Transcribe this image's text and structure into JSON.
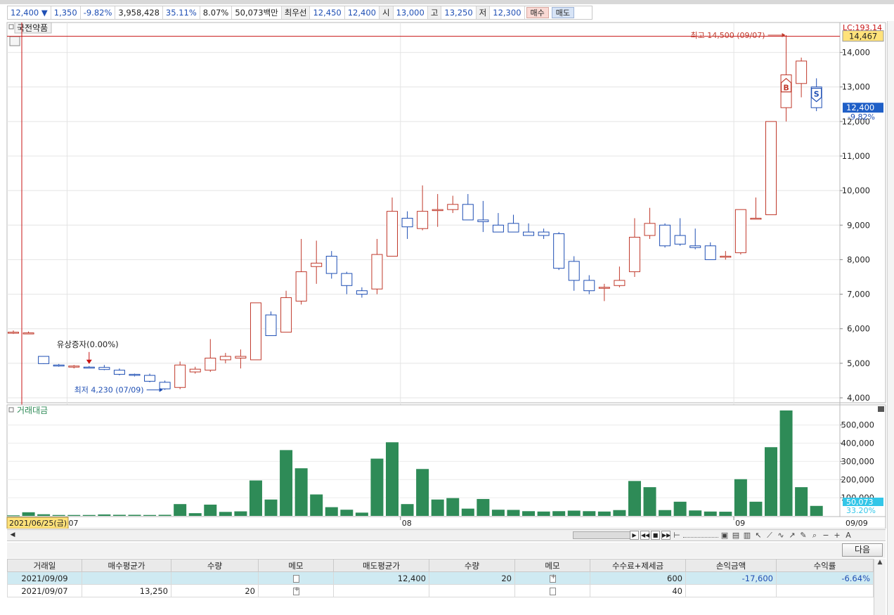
{
  "quote_bar": {
    "price": "12,400",
    "direction_icon": "triangle-down-icon",
    "change": "1,350",
    "change_rate": "-9.82%",
    "volume": "3,958,428",
    "rate2": "35.11%",
    "rate3": "8.07%",
    "amount": "50,073백만",
    "best_label": "최우선",
    "best_ask": "12,450",
    "best_bid": "12,400",
    "open_label": "시",
    "open": "13,000",
    "high_label": "고",
    "high": "13,250",
    "low_label": "저",
    "low": "12,300",
    "buy_label": "매수",
    "sell_label": "매도"
  },
  "price_panel": {
    "title": "국전약품",
    "lc_label": "LC:193.14",
    "crosshair_value": "14,467",
    "last_price": "12,400",
    "last_rate": "-9.82%",
    "high_note": "최고 14,500 (09/07)",
    "low_note": "최저 4,230 (07/09)",
    "event_note": "유상증자(0.00%)",
    "buy_marker": "B",
    "sell_marker": "S"
  },
  "volume_panel": {
    "title": "거래대금",
    "last_value": "50,073",
    "last_rate": "33.20%"
  },
  "x_axis": {
    "cursor_date": "2021/06/25(금)",
    "month_labels": [
      "07",
      "08",
      "09"
    ],
    "end_label": "09/09"
  },
  "chart_data": {
    "type": "candlestick",
    "price_ylim": [
      4000,
      14500
    ],
    "price_ticks": [
      4000,
      5000,
      6000,
      7000,
      8000,
      9000,
      10000,
      11000,
      12000,
      13000,
      14000
    ],
    "price_tick_labels": [
      "4,000",
      "5,000",
      "6,000",
      "7,000",
      "8,000",
      "9,000",
      "10,000",
      "11,000",
      "12,000",
      "13,000",
      "14,000"
    ],
    "volume_ylim": [
      0,
      580000
    ],
    "volume_ticks": [
      100000,
      200000,
      300000,
      400000,
      500000
    ],
    "volume_tick_labels": [
      "100,000",
      "200,000",
      "300,000",
      "400,000",
      "500,000"
    ],
    "candles": [
      {
        "o": 5900,
        "h": 5950,
        "l": 5850,
        "c": 5900
      },
      {
        "o": 5880,
        "h": 5920,
        "l": 5860,
        "c": 5880
      },
      {
        "o": 5200,
        "h": 5200,
        "l": 4980,
        "c": 4990
      },
      {
        "o": 4950,
        "h": 4980,
        "l": 4900,
        "c": 4930
      },
      {
        "o": 4900,
        "h": 4950,
        "l": 4850,
        "c": 4920
      },
      {
        "o": 4890,
        "h": 4920,
        "l": 4860,
        "c": 4870
      },
      {
        "o": 4880,
        "h": 4950,
        "l": 4800,
        "c": 4820
      },
      {
        "o": 4800,
        "h": 4850,
        "l": 4650,
        "c": 4680
      },
      {
        "o": 4680,
        "h": 4700,
        "l": 4620,
        "c": 4650
      },
      {
        "o": 4650,
        "h": 4700,
        "l": 4450,
        "c": 4480
      },
      {
        "o": 4450,
        "h": 4500,
        "l": 4230,
        "c": 4260
      },
      {
        "o": 4300,
        "h": 5050,
        "l": 4250,
        "c": 4950
      },
      {
        "o": 4750,
        "h": 4900,
        "l": 4700,
        "c": 4830
      },
      {
        "o": 4800,
        "h": 5700,
        "l": 4750,
        "c": 5150
      },
      {
        "o": 5100,
        "h": 5300,
        "l": 5000,
        "c": 5200
      },
      {
        "o": 5150,
        "h": 5400,
        "l": 4850,
        "c": 5200
      },
      {
        "o": 5100,
        "h": 6750,
        "l": 5100,
        "c": 6750
      },
      {
        "o": 6400,
        "h": 6500,
        "l": 5800,
        "c": 5800
      },
      {
        "o": 5900,
        "h": 7100,
        "l": 5900,
        "c": 6900
      },
      {
        "o": 6800,
        "h": 8600,
        "l": 6700,
        "c": 7650
      },
      {
        "o": 7800,
        "h": 8550,
        "l": 7300,
        "c": 7900
      },
      {
        "o": 8100,
        "h": 8250,
        "l": 7450,
        "c": 7600
      },
      {
        "o": 7600,
        "h": 7650,
        "l": 7000,
        "c": 7250
      },
      {
        "o": 7100,
        "h": 7200,
        "l": 6900,
        "c": 7000
      },
      {
        "o": 7150,
        "h": 8600,
        "l": 7000,
        "c": 8150
      },
      {
        "o": 8100,
        "h": 9800,
        "l": 8100,
        "c": 9400
      },
      {
        "o": 9200,
        "h": 9400,
        "l": 8600,
        "c": 8950
      },
      {
        "o": 8900,
        "h": 10150,
        "l": 8850,
        "c": 9400
      },
      {
        "o": 9450,
        "h": 9900,
        "l": 8950,
        "c": 9450
      },
      {
        "o": 9450,
        "h": 9850,
        "l": 9350,
        "c": 9600
      },
      {
        "o": 9600,
        "h": 9900,
        "l": 9150,
        "c": 9150
      },
      {
        "o": 9150,
        "h": 9700,
        "l": 8800,
        "c": 9100
      },
      {
        "o": 9000,
        "h": 9350,
        "l": 8800,
        "c": 8800
      },
      {
        "o": 9050,
        "h": 9300,
        "l": 8800,
        "c": 8800
      },
      {
        "o": 8800,
        "h": 9050,
        "l": 8700,
        "c": 8700
      },
      {
        "o": 8800,
        "h": 8900,
        "l": 8600,
        "c": 8700
      },
      {
        "o": 8750,
        "h": 8800,
        "l": 7700,
        "c": 7750
      },
      {
        "o": 7950,
        "h": 8100,
        "l": 7100,
        "c": 7400
      },
      {
        "o": 7400,
        "h": 7550,
        "l": 7000,
        "c": 7100
      },
      {
        "o": 7200,
        "h": 7300,
        "l": 6800,
        "c": 7200
      },
      {
        "o": 7250,
        "h": 7800,
        "l": 7200,
        "c": 7400
      },
      {
        "o": 7650,
        "h": 9200,
        "l": 7500,
        "c": 8650
      },
      {
        "o": 8700,
        "h": 9500,
        "l": 8600,
        "c": 9050
      },
      {
        "o": 9000,
        "h": 9050,
        "l": 8350,
        "c": 8400
      },
      {
        "o": 8700,
        "h": 9200,
        "l": 8400,
        "c": 8450
      },
      {
        "o": 8400,
        "h": 8900,
        "l": 8300,
        "c": 8350
      },
      {
        "o": 8400,
        "h": 8500,
        "l": 8000,
        "c": 8000
      },
      {
        "o": 8100,
        "h": 8250,
        "l": 8000,
        "c": 8100
      },
      {
        "o": 8200,
        "h": 9450,
        "l": 8150,
        "c": 9450
      },
      {
        "o": 9200,
        "h": 9800,
        "l": 9200,
        "c": 9200
      },
      {
        "o": 9300,
        "h": 12000,
        "l": 9300,
        "c": 12000
      },
      {
        "o": 12400,
        "h": 14500,
        "l": 12000,
        "c": 13350
      },
      {
        "o": 13100,
        "h": 13850,
        "l": 12700,
        "c": 13750
      },
      {
        "o": 13000,
        "h": 13250,
        "l": 12300,
        "c": 12400
      }
    ],
    "volumes": [
      3000,
      20000,
      9000,
      5000,
      5000,
      5000,
      8000,
      6000,
      6000,
      5000,
      6000,
      65000,
      15000,
      62000,
      22000,
      25000,
      195000,
      90000,
      362000,
      262000,
      118000,
      48000,
      34000,
      18000,
      315000,
      405000,
      65000,
      258000,
      90000,
      98000,
      40000,
      93000,
      34000,
      33000,
      26000,
      24000,
      26000,
      29000,
      26000,
      24000,
      32000,
      192000,
      158000,
      32000,
      78000,
      30000,
      24000,
      23000,
      202000,
      78000,
      378000,
      580000,
      158000,
      55000
    ]
  },
  "table": {
    "headers": [
      "거래일",
      "매수평균가",
      "수량",
      "메모",
      "매도평균가",
      "수량",
      "메모",
      "수수료+제세금",
      "손익금액",
      "수익률"
    ],
    "rows": [
      {
        "date": "2021/09/09",
        "buy_avg": "",
        "buy_qty": "",
        "memo1": "memo-icon",
        "sell_avg": "12,400",
        "sell_qty": "20",
        "memo2": "memo-add-icon",
        "fee": "600",
        "pnl": "-17,600",
        "rate": "-6.64%"
      },
      {
        "date": "2021/09/07",
        "buy_avg": "13,250",
        "buy_qty": "20",
        "memo1": "memo-add-icon",
        "sell_avg": "",
        "sell_qty": "",
        "memo2": "memo-icon",
        "fee": "40",
        "pnl": "",
        "rate": ""
      }
    ],
    "next_label": "다음"
  },
  "colors": {
    "up": "#c0392b",
    "down": "#1f4fb4",
    "volume_bar": "#2e8b57",
    "crosshair": "#c81414",
    "last_price_bg": "#1f5fc7",
    "last_volume_bg": "#33c6e8",
    "crosshair_label_bg": "#ffe27a"
  }
}
